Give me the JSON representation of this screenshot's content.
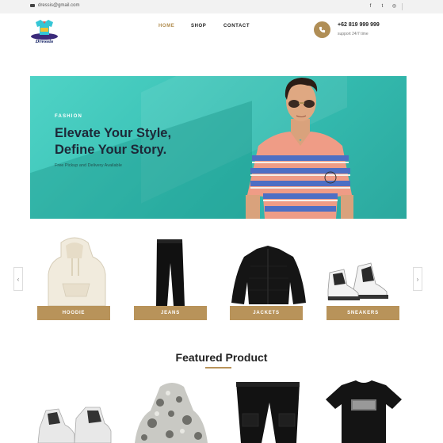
{
  "topbar": {
    "email": "dressis@gmail.com",
    "social": {
      "facebook": "f",
      "twitter": "t",
      "instagram": "◎"
    }
  },
  "header": {
    "logo_text": "Dressis",
    "nav": {
      "home": "HOME",
      "shop": "SHOP",
      "contact": "CONTACT"
    },
    "phone": {
      "number": "+62 819 999 999",
      "support": "support 24/7 time"
    }
  },
  "hero": {
    "eyebrow": "FASHION",
    "title_line1": "Elevate Your Style,",
    "title_line2": "Define Your Story.",
    "subtitle": "Free Pickup and Delivery Available"
  },
  "categories": {
    "prev": "‹",
    "next": "›",
    "items": [
      {
        "label": "HOODIE"
      },
      {
        "label": "JEANS"
      },
      {
        "label": "JACKETS"
      },
      {
        "label": "SNEAKERS"
      }
    ]
  },
  "featured": {
    "title": "Featured Product"
  },
  "colors": {
    "accent": "#b8935a",
    "nav_active": "#b18d4f",
    "hero_bg": "#3cc2b6",
    "heading": "#1d2838"
  }
}
